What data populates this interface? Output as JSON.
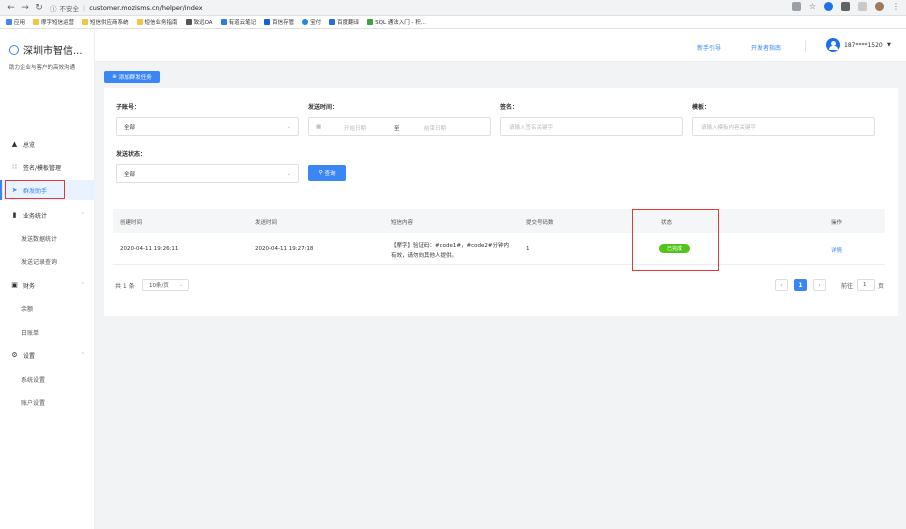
{
  "browser": {
    "security": "不安全",
    "url": "customer.mozisms.cn/helper/index",
    "bookmarks": [
      "应用",
      "摩字短信运营",
      "短信供应商系统",
      "短信业务指南",
      "致远OA",
      "有道云笔记",
      "百信存管",
      "宝付",
      "百度翻译",
      "SQL 通法入门 - 积..."
    ]
  },
  "header": {
    "guide_link": "新手引导",
    "dev_link": "开发者指南",
    "user_phone": "187****1520"
  },
  "sidebar": {
    "brand_name": "深圳市智信...",
    "brand_sub": "助力企业与客户的高效沟通",
    "items": [
      {
        "label": "总览"
      },
      {
        "label": "签名/模板管理"
      },
      {
        "label": "群发助手"
      },
      {
        "label": "业务统计"
      },
      {
        "label": "发送数据统计"
      },
      {
        "label": "发送记录查询"
      },
      {
        "label": "财务"
      },
      {
        "label": "余额"
      },
      {
        "label": "日账单"
      },
      {
        "label": "设置"
      },
      {
        "label": "系统设置"
      },
      {
        "label": "账户设置"
      }
    ]
  },
  "main": {
    "add_task_button": "添加群发任务",
    "filters": {
      "sub_account_label": "子账号：",
      "sub_account_value": "全部",
      "send_time_label": "发送时间：",
      "start_placeholder": "开始日期",
      "range_sep": "至",
      "end_placeholder": "结束日期",
      "sign_label": "签名：",
      "sign_placeholder": "请输入签名关键字",
      "template_label": "模板：",
      "template_placeholder": "请输入模板内容关键字",
      "status_label": "发送状态：",
      "status_value": "全部",
      "query_button": "查询"
    },
    "table": {
      "headers": [
        "创建时间",
        "发送时间",
        "短信内容",
        "提交号码数",
        "状态",
        "操作"
      ],
      "rows": [
        {
          "created": "2020-04-11 19:26:11",
          "sent": "2020-04-11 19:27:18",
          "content_line1": "【摩字】验证码：#code1#，#code2#分钟内",
          "content_line2": "有效，请勿向其他人提供。",
          "count": "1",
          "status": "已完成",
          "action": "详情"
        }
      ]
    },
    "pagination": {
      "total": "共 1 条",
      "page_size": "10条/页",
      "current_page": "1",
      "goto_label": "前往",
      "goto_value": "1",
      "page_unit": "页"
    }
  }
}
